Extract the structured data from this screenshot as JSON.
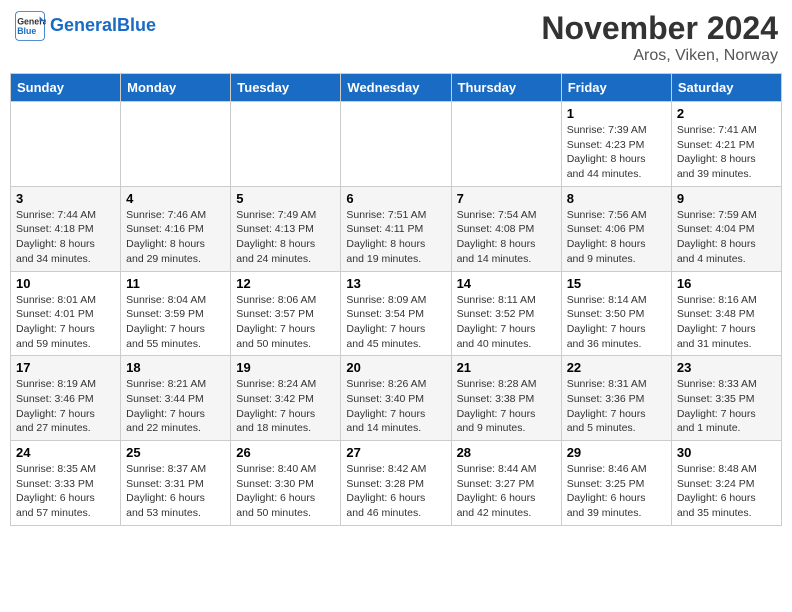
{
  "logo": {
    "line1": "General",
    "line2": "Blue"
  },
  "title": "November 2024",
  "location": "Aros, Viken, Norway",
  "weekdays": [
    "Sunday",
    "Monday",
    "Tuesday",
    "Wednesday",
    "Thursday",
    "Friday",
    "Saturday"
  ],
  "weeks": [
    [
      {
        "day": "",
        "info": ""
      },
      {
        "day": "",
        "info": ""
      },
      {
        "day": "",
        "info": ""
      },
      {
        "day": "",
        "info": ""
      },
      {
        "day": "",
        "info": ""
      },
      {
        "day": "1",
        "info": "Sunrise: 7:39 AM\nSunset: 4:23 PM\nDaylight: 8 hours and 44 minutes."
      },
      {
        "day": "2",
        "info": "Sunrise: 7:41 AM\nSunset: 4:21 PM\nDaylight: 8 hours and 39 minutes."
      }
    ],
    [
      {
        "day": "3",
        "info": "Sunrise: 7:44 AM\nSunset: 4:18 PM\nDaylight: 8 hours and 34 minutes."
      },
      {
        "day": "4",
        "info": "Sunrise: 7:46 AM\nSunset: 4:16 PM\nDaylight: 8 hours and 29 minutes."
      },
      {
        "day": "5",
        "info": "Sunrise: 7:49 AM\nSunset: 4:13 PM\nDaylight: 8 hours and 24 minutes."
      },
      {
        "day": "6",
        "info": "Sunrise: 7:51 AM\nSunset: 4:11 PM\nDaylight: 8 hours and 19 minutes."
      },
      {
        "day": "7",
        "info": "Sunrise: 7:54 AM\nSunset: 4:08 PM\nDaylight: 8 hours and 14 minutes."
      },
      {
        "day": "8",
        "info": "Sunrise: 7:56 AM\nSunset: 4:06 PM\nDaylight: 8 hours and 9 minutes."
      },
      {
        "day": "9",
        "info": "Sunrise: 7:59 AM\nSunset: 4:04 PM\nDaylight: 8 hours and 4 minutes."
      }
    ],
    [
      {
        "day": "10",
        "info": "Sunrise: 8:01 AM\nSunset: 4:01 PM\nDaylight: 7 hours and 59 minutes."
      },
      {
        "day": "11",
        "info": "Sunrise: 8:04 AM\nSunset: 3:59 PM\nDaylight: 7 hours and 55 minutes."
      },
      {
        "day": "12",
        "info": "Sunrise: 8:06 AM\nSunset: 3:57 PM\nDaylight: 7 hours and 50 minutes."
      },
      {
        "day": "13",
        "info": "Sunrise: 8:09 AM\nSunset: 3:54 PM\nDaylight: 7 hours and 45 minutes."
      },
      {
        "day": "14",
        "info": "Sunrise: 8:11 AM\nSunset: 3:52 PM\nDaylight: 7 hours and 40 minutes."
      },
      {
        "day": "15",
        "info": "Sunrise: 8:14 AM\nSunset: 3:50 PM\nDaylight: 7 hours and 36 minutes."
      },
      {
        "day": "16",
        "info": "Sunrise: 8:16 AM\nSunset: 3:48 PM\nDaylight: 7 hours and 31 minutes."
      }
    ],
    [
      {
        "day": "17",
        "info": "Sunrise: 8:19 AM\nSunset: 3:46 PM\nDaylight: 7 hours and 27 minutes."
      },
      {
        "day": "18",
        "info": "Sunrise: 8:21 AM\nSunset: 3:44 PM\nDaylight: 7 hours and 22 minutes."
      },
      {
        "day": "19",
        "info": "Sunrise: 8:24 AM\nSunset: 3:42 PM\nDaylight: 7 hours and 18 minutes."
      },
      {
        "day": "20",
        "info": "Sunrise: 8:26 AM\nSunset: 3:40 PM\nDaylight: 7 hours and 14 minutes."
      },
      {
        "day": "21",
        "info": "Sunrise: 8:28 AM\nSunset: 3:38 PM\nDaylight: 7 hours and 9 minutes."
      },
      {
        "day": "22",
        "info": "Sunrise: 8:31 AM\nSunset: 3:36 PM\nDaylight: 7 hours and 5 minutes."
      },
      {
        "day": "23",
        "info": "Sunrise: 8:33 AM\nSunset: 3:35 PM\nDaylight: 7 hours and 1 minute."
      }
    ],
    [
      {
        "day": "24",
        "info": "Sunrise: 8:35 AM\nSunset: 3:33 PM\nDaylight: 6 hours and 57 minutes."
      },
      {
        "day": "25",
        "info": "Sunrise: 8:37 AM\nSunset: 3:31 PM\nDaylight: 6 hours and 53 minutes."
      },
      {
        "day": "26",
        "info": "Sunrise: 8:40 AM\nSunset: 3:30 PM\nDaylight: 6 hours and 50 minutes."
      },
      {
        "day": "27",
        "info": "Sunrise: 8:42 AM\nSunset: 3:28 PM\nDaylight: 6 hours and 46 minutes."
      },
      {
        "day": "28",
        "info": "Sunrise: 8:44 AM\nSunset: 3:27 PM\nDaylight: 6 hours and 42 minutes."
      },
      {
        "day": "29",
        "info": "Sunrise: 8:46 AM\nSunset: 3:25 PM\nDaylight: 6 hours and 39 minutes."
      },
      {
        "day": "30",
        "info": "Sunrise: 8:48 AM\nSunset: 3:24 PM\nDaylight: 6 hours and 35 minutes."
      }
    ]
  ]
}
